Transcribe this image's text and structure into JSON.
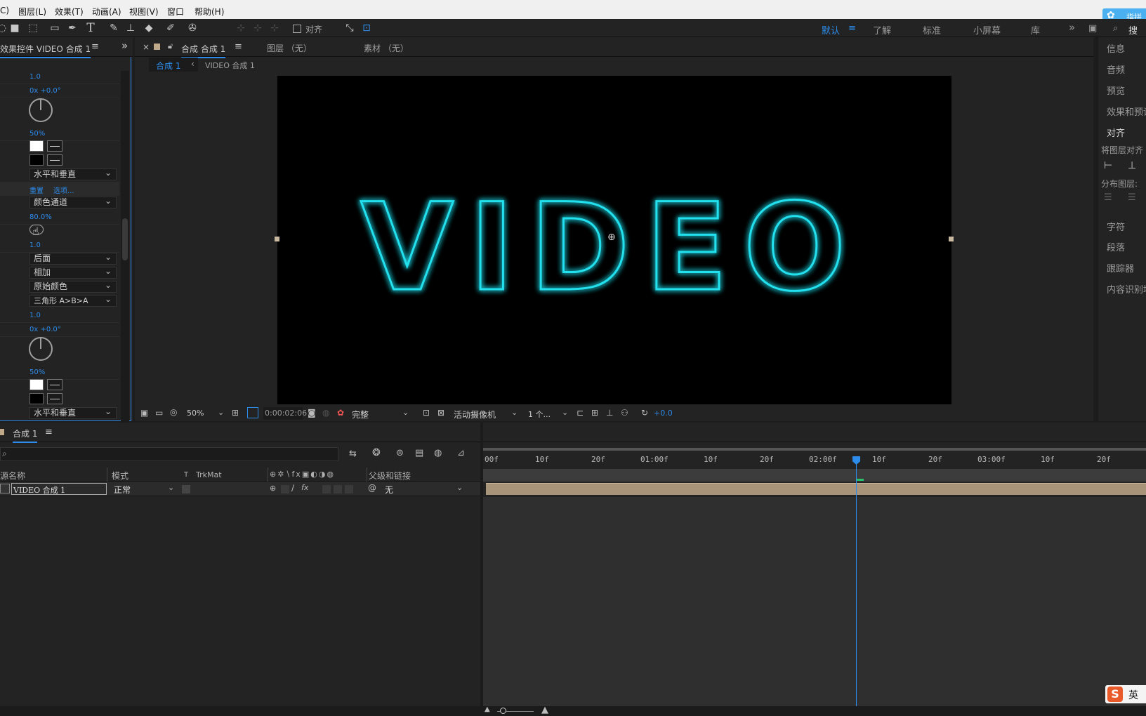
{
  "menubar": {
    "items": [
      "C)",
      "图层(L)",
      "效果(T)",
      "动画(A)",
      "视图(V)",
      "窗口",
      "帮助(H)"
    ]
  },
  "toolbar": {
    "align_label": "对齐",
    "workspaces": [
      "默认",
      "了解",
      "标准",
      "小屏幕",
      "库"
    ],
    "search_label": "搜索",
    "badge_label": "指拼"
  },
  "effects_panel": {
    "tab_title": "效果控件 VIDEO 合成 1",
    "values": {
      "v1": "1.0",
      "v2": "0x +0.0°",
      "v3": "50%",
      "v4": "80.0%",
      "v5": "1.0",
      "v6": "1.0",
      "v7": "0x +0.0°",
      "v8": "50%"
    },
    "reset": "重置",
    "options": "选项...",
    "dropdowns": {
      "d1": "水平和垂直",
      "d2": "颜色通道",
      "d3": "后面",
      "d4": "相加",
      "d5": "原始颜色",
      "d6": "三角形 A>B>A",
      "d7": "水平和垂直"
    }
  },
  "comp_panel": {
    "close": "×",
    "tab_title": "合成 合成 1",
    "layer_tab": "图层 （无）",
    "footage_tab": "素材 （无）",
    "breadcrumb_active": "合成 1",
    "breadcrumb_next": "VIDEO 合成 1",
    "canvas_text": "VIDEO",
    "zoom": "50%",
    "timecode": "0:00:02:06",
    "quality": "完整",
    "camera": "活动摄像机",
    "views": "1 个...",
    "exposure": "+0.0"
  },
  "right_panel": {
    "items": [
      "信息",
      "音频",
      "预览",
      "效果和预设",
      "对齐",
      "将图层对齐",
      "分布图层:",
      "字符",
      "段落",
      "跟踪器",
      "内容识别填"
    ]
  },
  "timeline": {
    "tab_title": "合成 1",
    "columns": {
      "source_name": "源名称",
      "mode": "模式",
      "t": "T",
      "trkmat": "TrkMat",
      "parent": "父级和链接"
    },
    "layer": {
      "name": "VIDEO 合成 1",
      "mode": "正常",
      "parent": "无"
    },
    "ruler": [
      "00f",
      "10f",
      "20f",
      "01:00f",
      "10f",
      "20f",
      "02:00f",
      "10f",
      "20f",
      "03:00f",
      "10f",
      "20f"
    ]
  },
  "ime": {
    "label": "英"
  },
  "colors": {
    "accent": "#2d8ceb",
    "neon": "#22e0ee",
    "layer_bar": "#a89478"
  }
}
